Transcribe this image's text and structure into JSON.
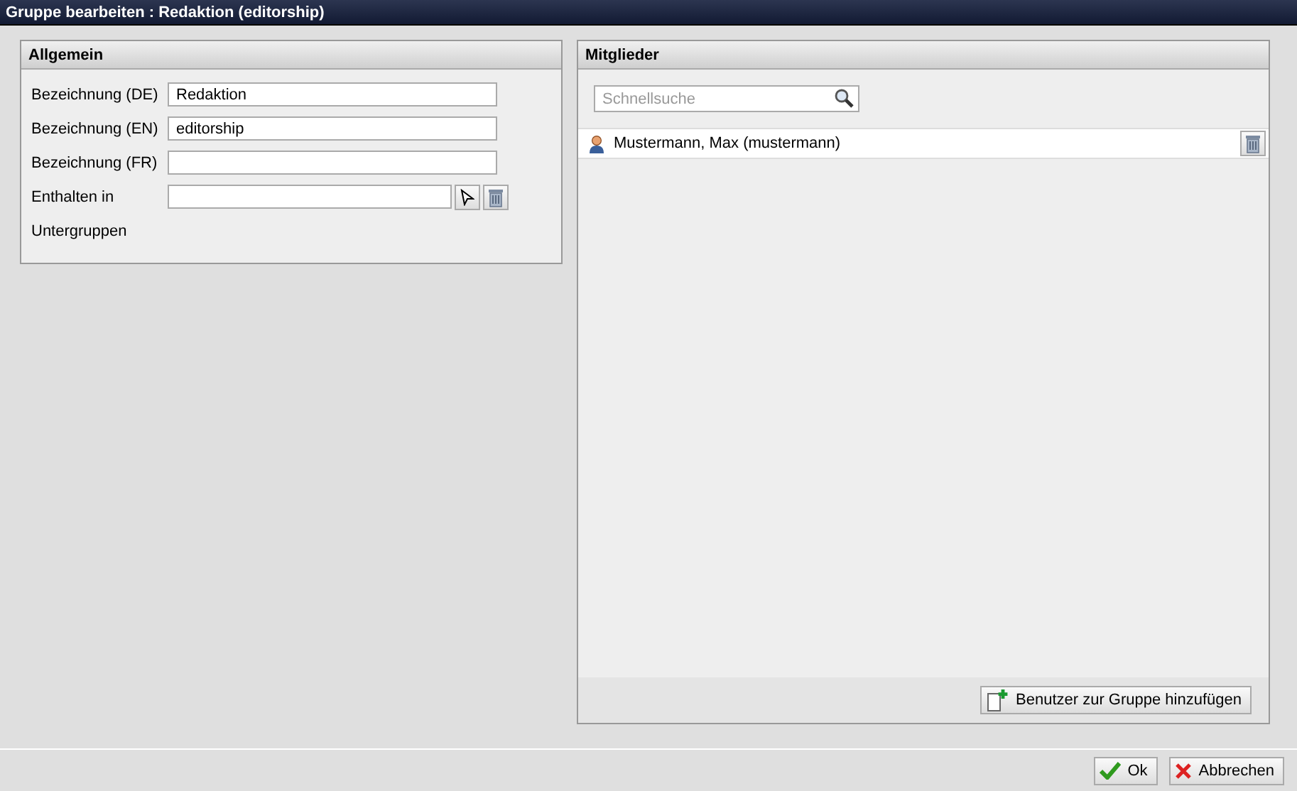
{
  "window": {
    "title": "Gruppe bearbeiten : Redaktion (editorship)"
  },
  "general": {
    "title": "Allgemein",
    "fields": [
      {
        "kind": "text",
        "label": "Bezeichnung (DE)",
        "value": "Redaktion"
      },
      {
        "kind": "text",
        "label": "Bezeichnung (EN)",
        "value": "editorship"
      },
      {
        "kind": "text",
        "label": "Bezeichnung (FR)"
      },
      {
        "kind": "picker",
        "label": "Enthalten in"
      },
      {
        "kind": "label",
        "label": "Untergruppen"
      }
    ]
  },
  "members": {
    "title": "Mitglieder",
    "search": {
      "placeholder": "Schnellsuche"
    },
    "rows": [
      {
        "name": "Mustermann, Max (mustermann)"
      }
    ],
    "add_button": "Benutzer zur Gruppe hinzufügen"
  },
  "buttons": [
    {
      "kind": "ok",
      "label": "Ok"
    },
    {
      "kind": "cancel",
      "label": "Abbrechen"
    }
  ]
}
